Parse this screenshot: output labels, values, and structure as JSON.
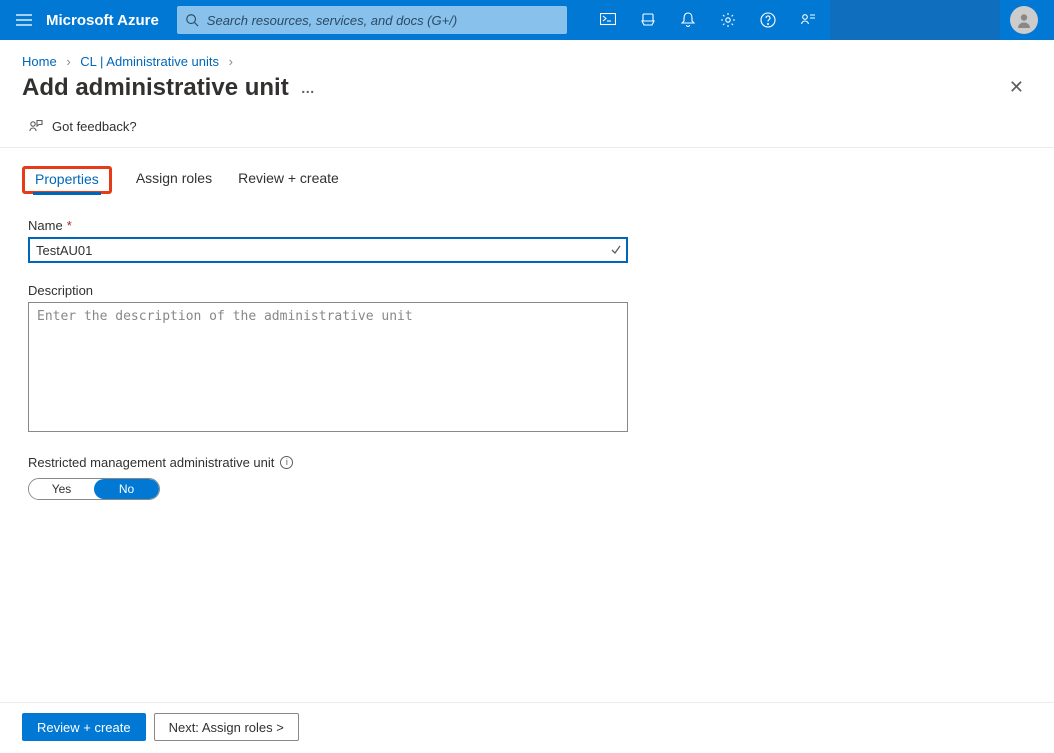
{
  "header": {
    "brand": "Microsoft Azure",
    "search_placeholder": "Search resources, services, and docs (G+/)"
  },
  "breadcrumb": {
    "home": "Home",
    "parent": "CL | Administrative units"
  },
  "title": "Add administrative unit",
  "feedback_label": "Got feedback?",
  "tabs": {
    "properties": "Properties",
    "assign_roles": "Assign roles",
    "review": "Review + create"
  },
  "form": {
    "name_label": "Name",
    "name_value": "TestAU01",
    "description_label": "Description",
    "description_placeholder": "Enter the description of the administrative unit",
    "restricted_label": "Restricted management administrative unit",
    "toggle_yes": "Yes",
    "toggle_no": "No",
    "toggle_value": "No"
  },
  "footer": {
    "primary": "Review + create",
    "secondary": "Next: Assign roles >"
  }
}
